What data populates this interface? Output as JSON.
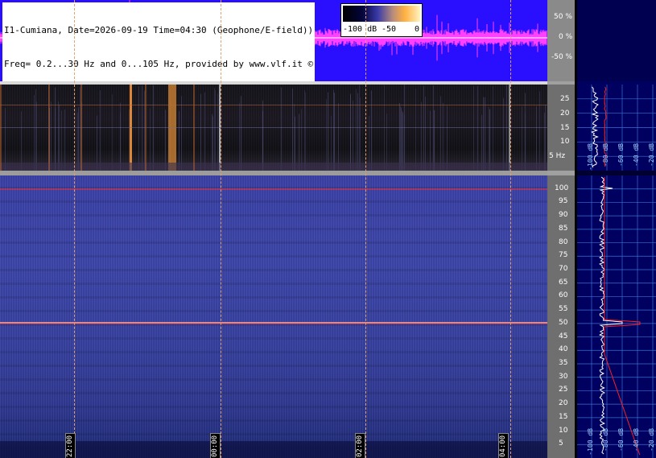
{
  "info": {
    "line1": "I1-Cumiana, Date=2026-09-19 Time=04:30 (Geophone/E-field))",
    "line2": "Freq= 0.2...30 Hz and 0...105 Hz, provided by www.vlf.it ©"
  },
  "colorbar": {
    "min_label": "-100 dB",
    "mid_label": "-50",
    "max_label": "0"
  },
  "wave_scale": [
    "50 %",
    "0 %",
    "-50 %"
  ],
  "upper_scale": [
    "25",
    "20",
    "15",
    "10",
    "5 Hz"
  ],
  "lower_scale": [
    "100",
    "95",
    "90",
    "85",
    "80",
    "75",
    "70",
    "65",
    "60",
    "55",
    "50",
    "45",
    "40",
    "35",
    "30",
    "25",
    "20",
    "15",
    "10",
    "5"
  ],
  "time_labels": [
    "22:00",
    "00:00",
    "02:00",
    "04:00"
  ],
  "spec_upper_labels": [
    "-100 dB",
    "-80 dB",
    "-60 dB",
    "-40 dB",
    "-20 dB"
  ],
  "spec_lower_labels": [
    "-100 dB",
    "-80 dB",
    "-60 dB",
    "-40 dB",
    "-20 dB"
  ],
  "colors": {
    "wave_bg": "#2a0fff",
    "wave_trace": "#ff40ff",
    "grid": "#e0a070",
    "spec_bg": "#000060",
    "redline": "#ff2020"
  }
}
